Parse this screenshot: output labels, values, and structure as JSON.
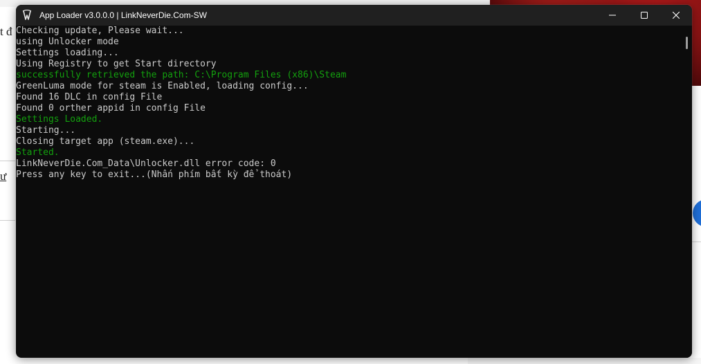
{
  "background": {
    "left_text_top": "t đ",
    "left_text_mid": "ư"
  },
  "window": {
    "title": "App Loader v3.0.0.0 | LinkNeverDie.Com-SW",
    "icon": "app-loader-icon",
    "controls": [
      "minimize-icon",
      "maximize-icon",
      "close-icon"
    ]
  },
  "console": {
    "lines": [
      {
        "text": "Checking update, Please wait...",
        "color": "#cccccc"
      },
      {
        "text": "using Unlocker mode",
        "color": "#cccccc"
      },
      {
        "text": "Settings loading...",
        "color": "#cccccc"
      },
      {
        "text": "Using Registry to get Start directory",
        "color": "#cccccc"
      },
      {
        "text": "successfully retrieved the path: C:\\Program Files (x86)\\Steam",
        "color": "#13a10e"
      },
      {
        "text": "GreenLuma mode for steam is Enabled, loading config...",
        "color": "#cccccc"
      },
      {
        "text": "Found 16 DLC in config File",
        "color": "#cccccc"
      },
      {
        "text": "Found 0 orther appid in config File",
        "color": "#cccccc"
      },
      {
        "text": "Settings Loaded.",
        "color": "#13a10e"
      },
      {
        "text": "Starting...",
        "color": "#cccccc"
      },
      {
        "text": "Closing target app (steam.exe)...",
        "color": "#cccccc"
      },
      {
        "text": "Started.",
        "color": "#13a10e"
      },
      {
        "text": "LinkNeverDie.Com_Data\\Unlocker.dll error code: 0",
        "color": "#cccccc"
      },
      {
        "text": "Press any key to exit...(Nhấn phím bất kỳ để thoát)",
        "color": "#cccccc"
      }
    ]
  },
  "colors": {
    "console_bg": "#0c0c0c",
    "titlebar_bg": "#202020",
    "text_default": "#cccccc",
    "text_success": "#13a10e"
  }
}
